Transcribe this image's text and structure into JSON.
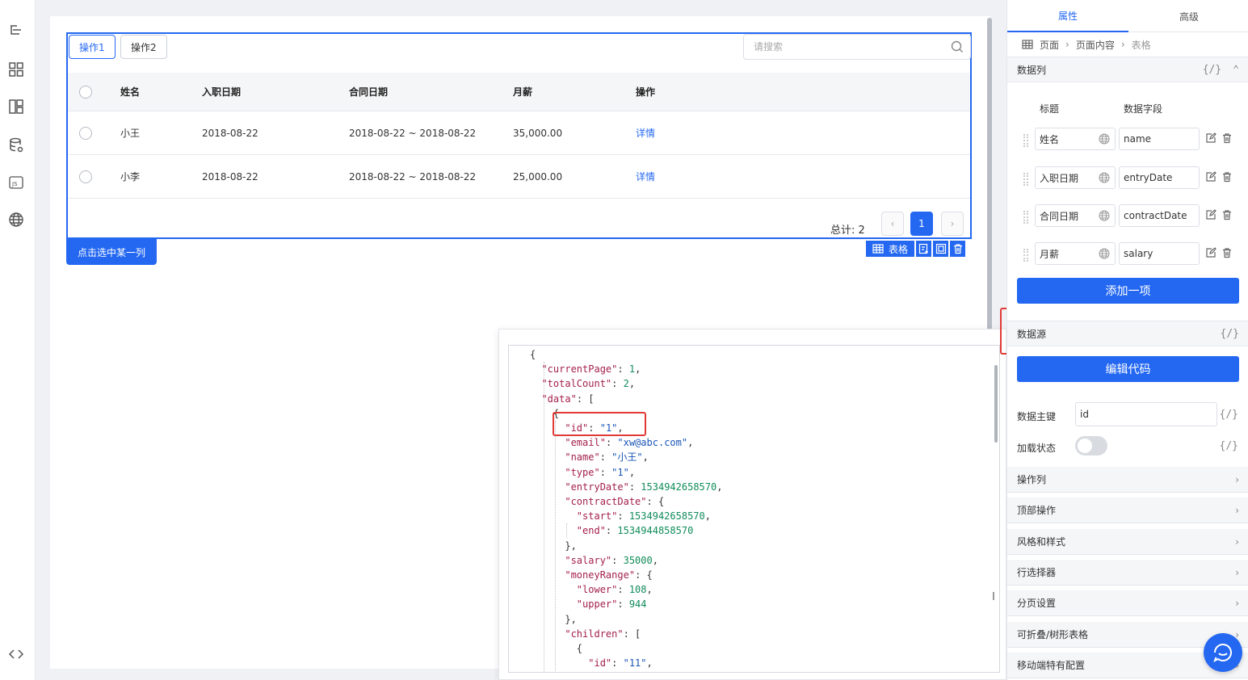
{
  "table": {
    "toolbar": {
      "op1": "操作1",
      "op2": "操作2",
      "search_placeholder": "请搜索"
    },
    "columns": [
      "姓名",
      "入职日期",
      "合同日期",
      "月薪",
      "操作"
    ],
    "rows": [
      {
        "name": "小王",
        "entry": "2018-08-22",
        "contract": "2018-08-22 ~ 2018-08-22",
        "salary": "35,000.00",
        "action": "详情"
      },
      {
        "name": "小李",
        "entry": "2018-08-22",
        "contract": "2018-08-22 ~ 2018-08-22",
        "salary": "25,000.00",
        "action": "详情"
      }
    ],
    "total": "总计: 2",
    "current_page": "1",
    "select_column_button": "点击选中某一列",
    "component_tag": "表格"
  },
  "code": {
    "lines": [
      "{",
      "  \"currentPage\": 1,",
      "  \"totalCount\": 2,",
      "  \"data\": [",
      "    {",
      "      \"id\": \"1\",",
      "      \"email\": \"xw@abc.com\",",
      "      \"name\": \"小王\",",
      "      \"type\": \"1\",",
      "      \"entryDate\": 1534942658570,",
      "      \"contractDate\": {",
      "        \"start\": 1534942658570,",
      "        \"end\": 1534944858570",
      "      },",
      "      \"salary\": 35000,",
      "      \"moneyRange\": {",
      "        \"lower\": 108,",
      "        \"upper\": 944",
      "      },",
      "      \"children\": [",
      "        {",
      "          \"id\": \"11\","
    ]
  },
  "panel": {
    "tabs": [
      "属性",
      "高级"
    ],
    "breadcrumb": [
      "页面",
      "页面内容",
      "表格"
    ],
    "data_columns_title": "数据列",
    "fx": "{/}",
    "col_header_title": "标题",
    "col_header_field": "数据字段",
    "columns": [
      {
        "title": "姓名",
        "field": "name"
      },
      {
        "title": "入职日期",
        "field": "entryDate"
      },
      {
        "title": "合同日期",
        "field": "contractDate"
      },
      {
        "title": "月薪",
        "field": "salary"
      }
    ],
    "add_item": "添加一项",
    "data_source_title": "数据源",
    "edit_code": "编辑代码",
    "primary_key_label": "数据主键",
    "primary_key_value": "id",
    "loading_label": "加载状态",
    "sections": [
      "操作列",
      "顶部操作",
      "风格和样式",
      "行选择器",
      "分页设置",
      "可折叠/树形表格",
      "移动端特有配置"
    ]
  },
  "colors": {
    "primary": "#2468f2",
    "highlight": "#e03a36"
  }
}
